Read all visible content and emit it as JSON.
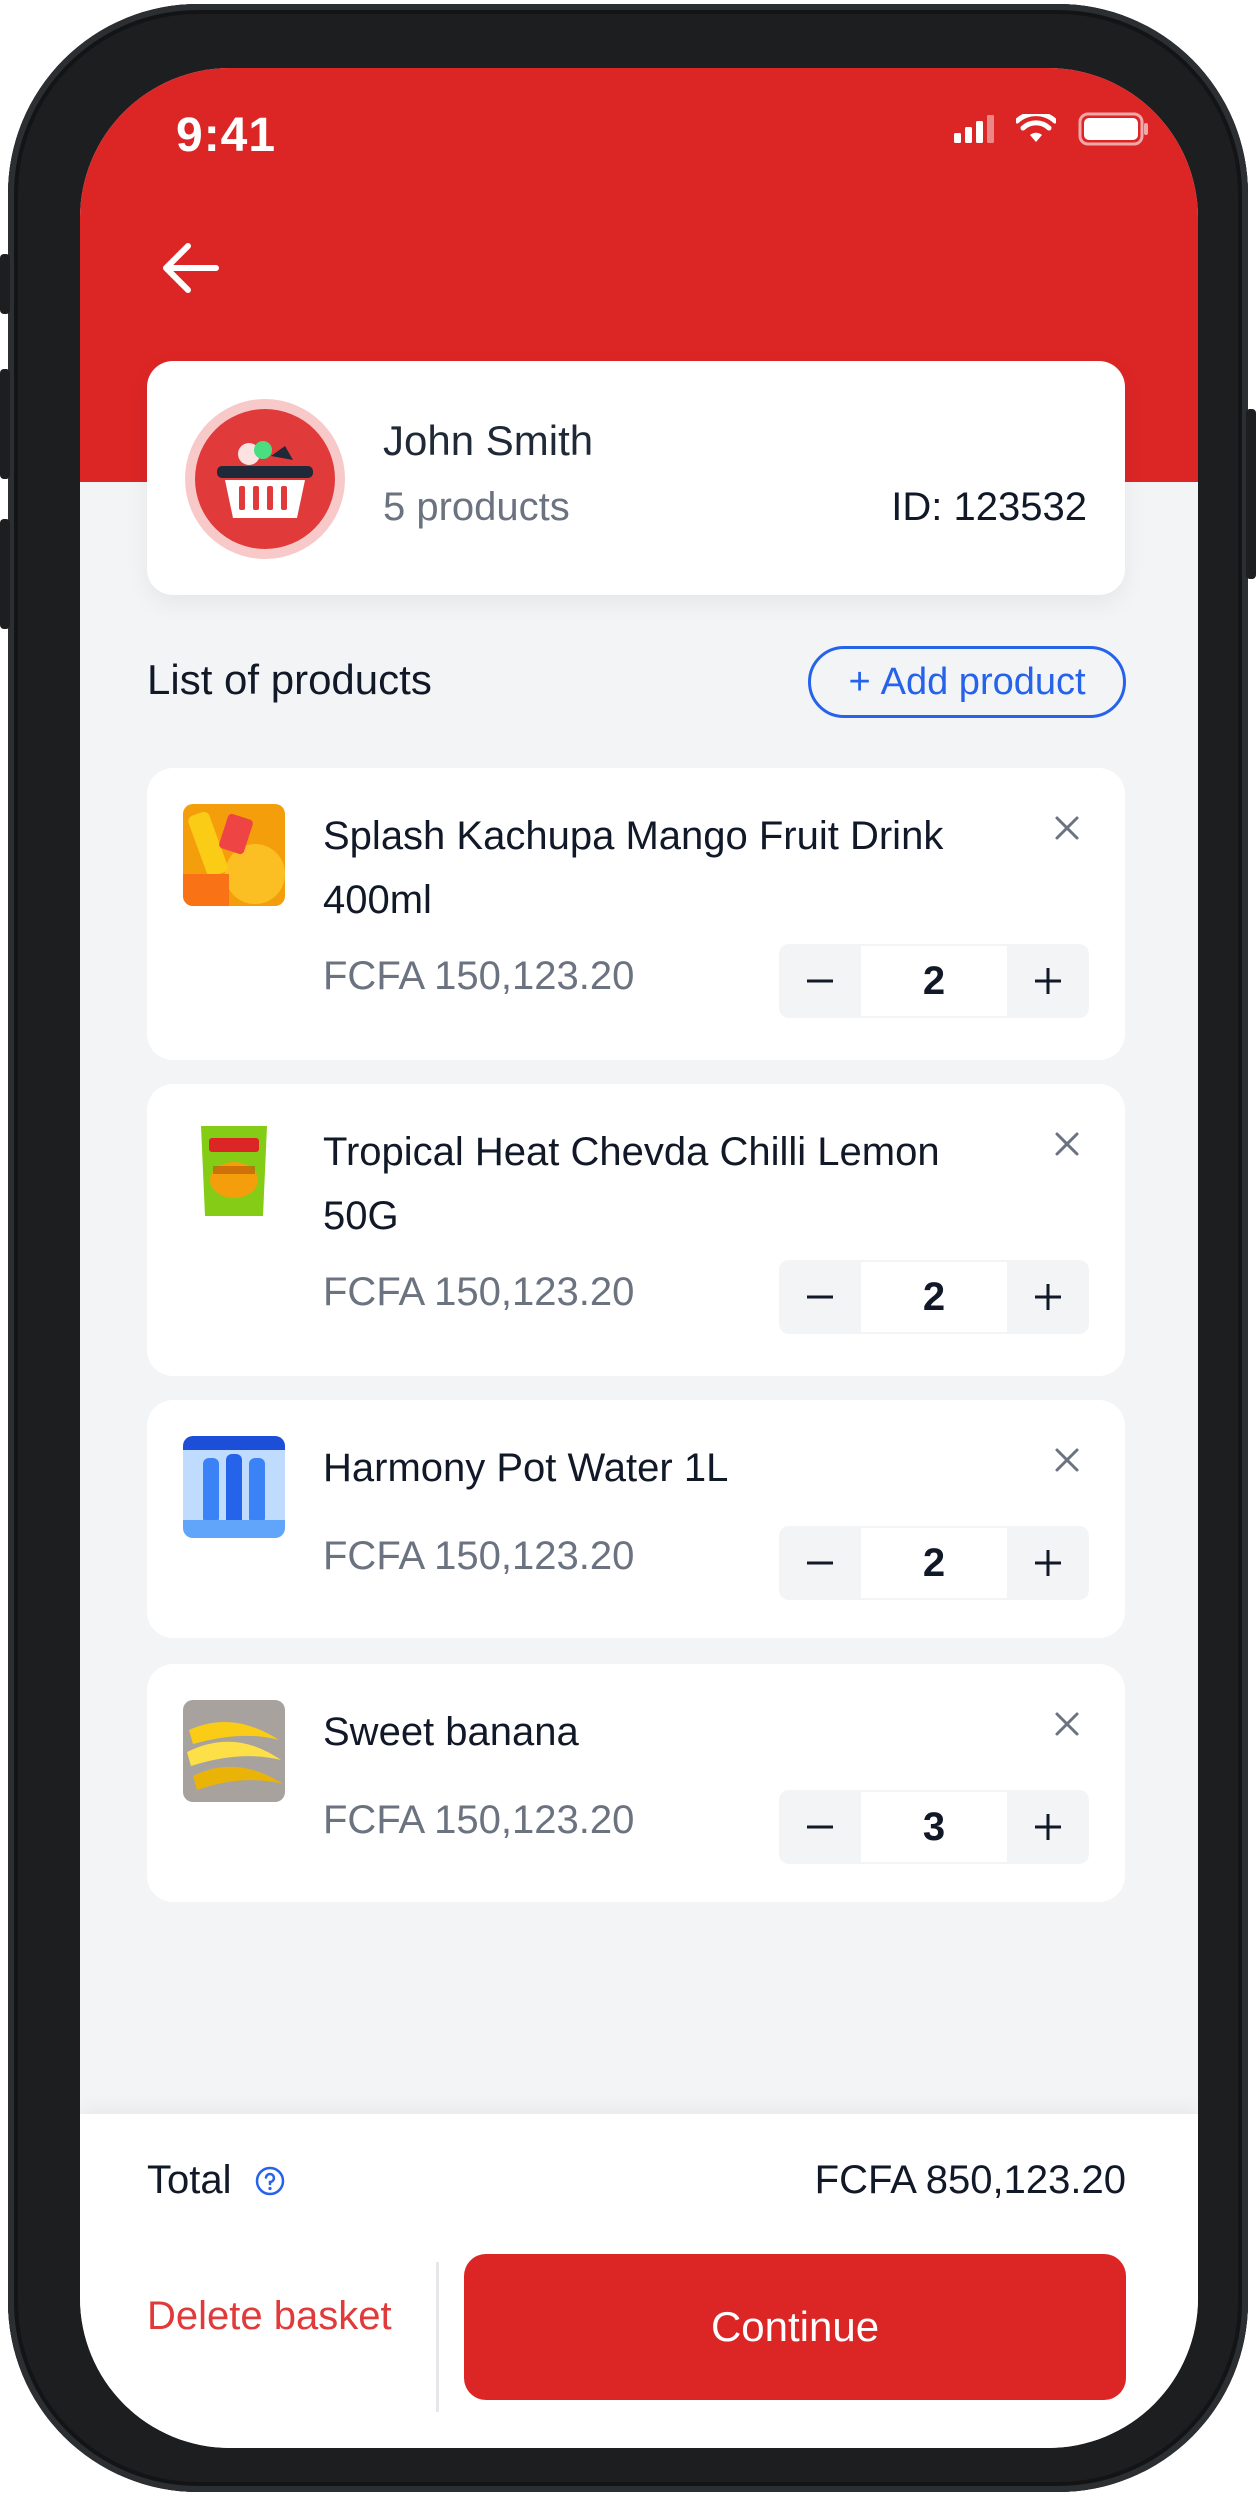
{
  "status_bar": {
    "time": "9:41"
  },
  "customer": {
    "name": "John Smith",
    "products_count": "5 products",
    "id": "ID: 123532"
  },
  "products_section": {
    "title": "List of products",
    "add_button_icon": "+",
    "add_button_label": "Add product"
  },
  "products": [
    {
      "name": "Splash Kachupa Mango Fruit Drink 400ml",
      "price": "FCFA 150,123.20",
      "quantity": "2",
      "image": "mango-drink"
    },
    {
      "name": "Tropical Heat Chevda Chilli Lemon 50G",
      "price": "FCFA 150,123.20",
      "quantity": "2",
      "image": "snack-pack"
    },
    {
      "name": "Harmony Pot Water 1L",
      "price": "FCFA 150,123.20",
      "quantity": "2",
      "image": "water-bottles"
    },
    {
      "name": "Sweet banana",
      "price": "FCFA 150,123.20",
      "quantity": "3",
      "image": "bananas"
    }
  ],
  "footer": {
    "total_label": "Total",
    "total_value": "FCFA 850,123.20",
    "delete_label": "Delete basket",
    "continue_label": "Continue"
  },
  "colors": {
    "brand_red": "#dc2626",
    "link_blue": "#2563eb",
    "muted_text": "#6b7280"
  }
}
